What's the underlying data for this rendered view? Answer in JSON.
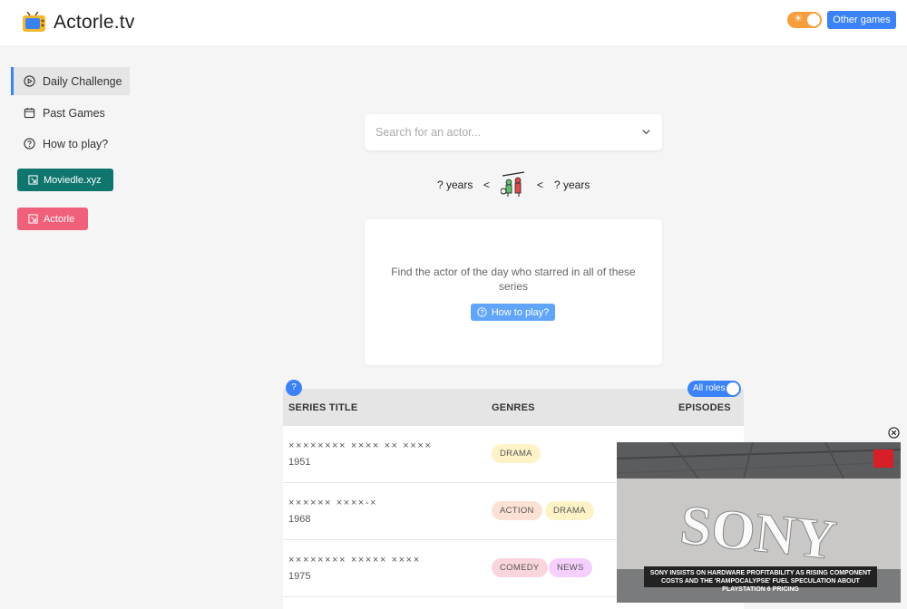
{
  "header": {
    "site_title": "Actorle.tv",
    "theme_icon": "☀",
    "other_games_label": "Other games"
  },
  "sidebar": {
    "items": [
      {
        "label": "Daily Challenge",
        "icon": "play-circle-icon"
      },
      {
        "label": "Past Games",
        "icon": "calendar-icon"
      },
      {
        "label": "How to play?",
        "icon": "help-circle-icon"
      }
    ],
    "links": [
      {
        "label": "Moviedle.xyz",
        "color": "#0f766e"
      },
      {
        "label": "Actorle",
        "color": "#f0607a"
      }
    ]
  },
  "search": {
    "placeholder": "Search for an actor..."
  },
  "age_hint": {
    "left": "? years",
    "right": "? years",
    "comparator": "<"
  },
  "intro": {
    "description": "Find the actor of the day who starred in all of these series",
    "how_button": "How to play?"
  },
  "table": {
    "help_badge": "?",
    "roles_toggle": "All roles",
    "columns": [
      "SERIES TITLE",
      "GENRES",
      "EPISODES"
    ],
    "rows": [
      {
        "title": "×××××××× ×××× ×× ××××",
        "year": "1951",
        "genres": [
          {
            "label": "DRAMA",
            "color": "#fef3c7"
          }
        ]
      },
      {
        "title": "×××××× ××××-×",
        "year": "1968",
        "genres": [
          {
            "label": "ACTION",
            "color": "#fde2d4"
          },
          {
            "label": "DRAMA",
            "color": "#fef3c7"
          }
        ]
      },
      {
        "title": "×××××××× ××××× ××××",
        "year": "1975",
        "genres": [
          {
            "label": "COMEDY",
            "color": "#fbd5dc"
          },
          {
            "label": "NEWS",
            "color": "#f5d0fe"
          }
        ]
      }
    ]
  },
  "video": {
    "headline": "SONY INSISTS ON HARDWARE PROFITABILITY AS RISING COMPONENT COSTS AND THE 'RAMPOCALYPSE' FUEL SPECULATION ABOUT PLAYSTATION 6 PRICING",
    "sign_text": "SONY"
  }
}
